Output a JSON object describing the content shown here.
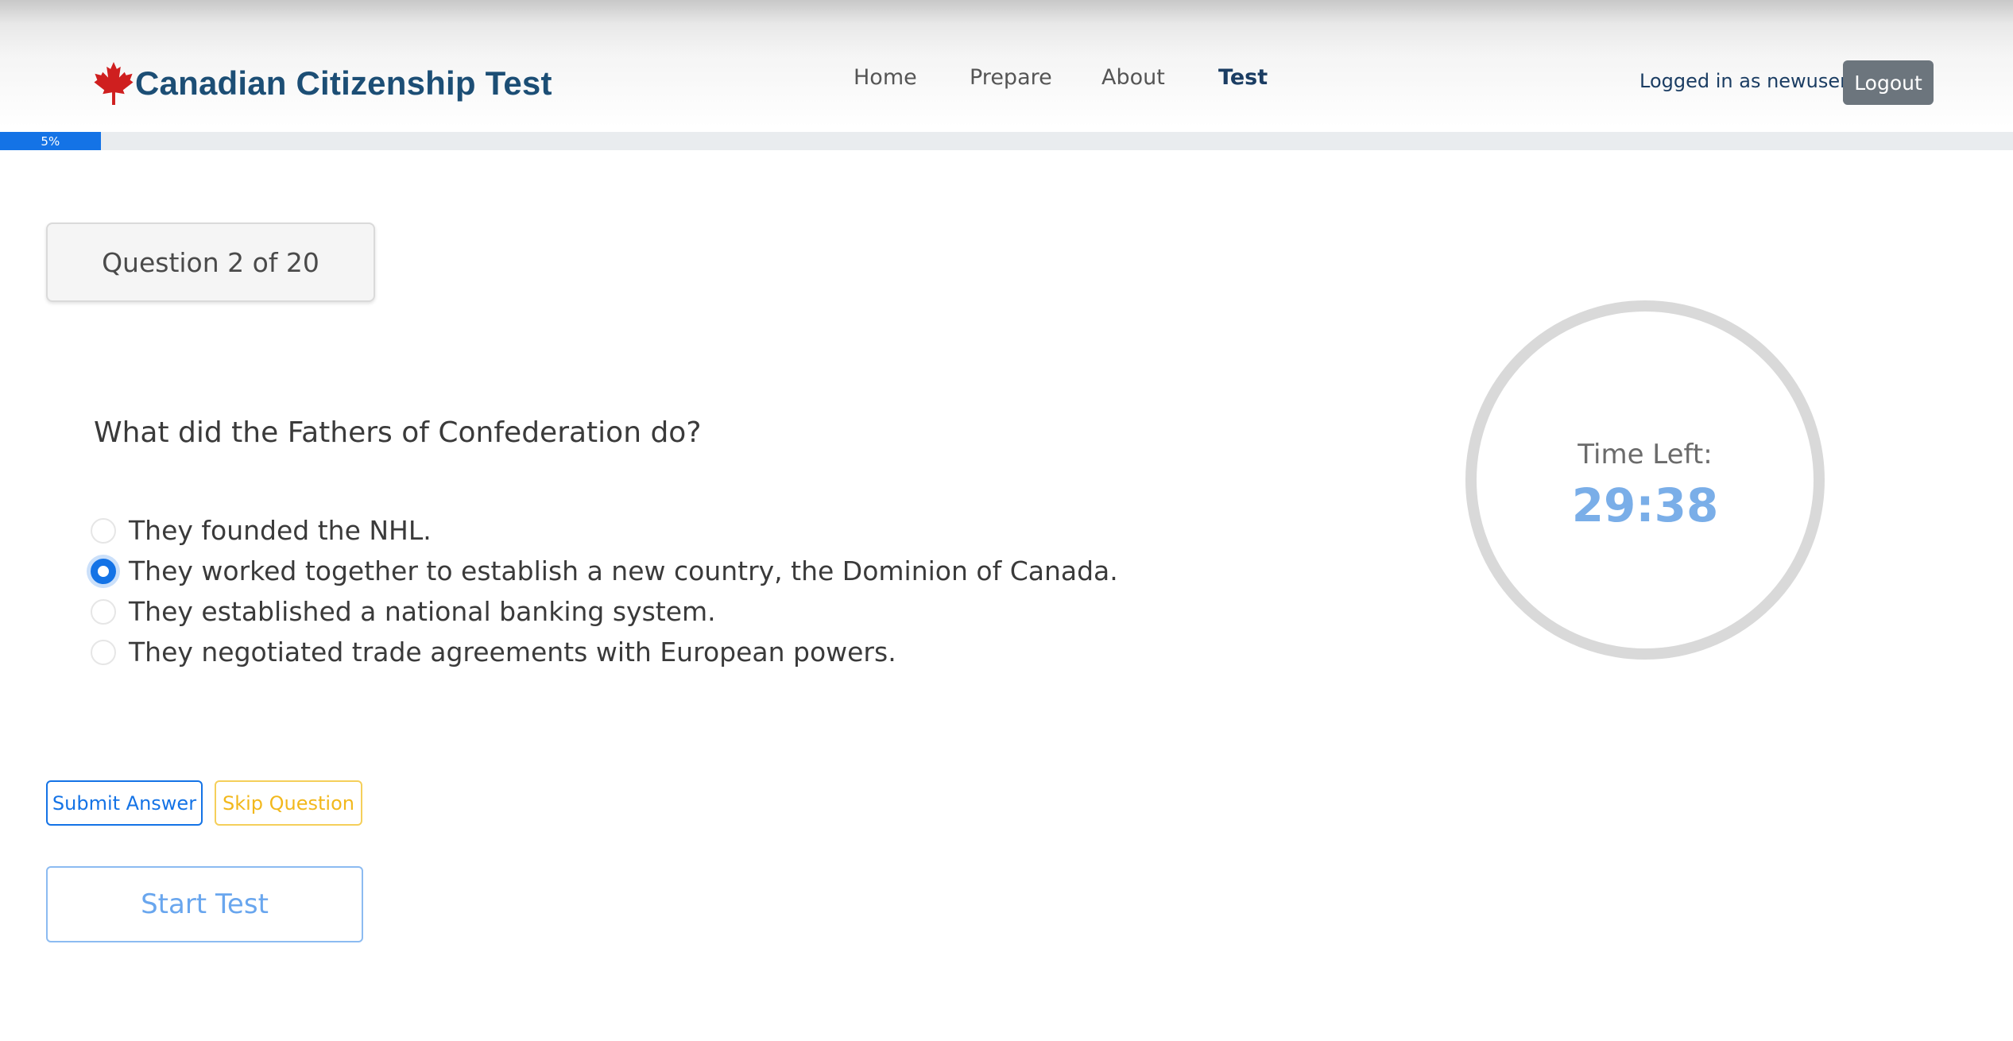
{
  "header": {
    "brand_title": "Canadian Citizenship Test",
    "brand_icon": "maple-leaf-icon",
    "brand_color": "#1c4e75",
    "nav": [
      {
        "label": "Home",
        "active": false
      },
      {
        "label": "Prepare",
        "active": false
      },
      {
        "label": "About",
        "active": false
      },
      {
        "label": "Test",
        "active": true
      }
    ],
    "user_label": "Logged in as newuser",
    "logout_label": "Logout"
  },
  "progress": {
    "percent": 5,
    "label": "5%",
    "color": "#1473e6"
  },
  "quiz": {
    "counter": "Question 2 of 20",
    "question": "What did the Fathers of Confederation do?",
    "options": [
      {
        "label": "They founded the NHL.",
        "selected": false
      },
      {
        "label": "They worked together to establish a new country, the Dominion of Canada.",
        "selected": true
      },
      {
        "label": "They established a national banking system.",
        "selected": false
      },
      {
        "label": "They negotiated trade agreements with European powers.",
        "selected": false
      }
    ]
  },
  "timer": {
    "label": "Time Left:",
    "value": "29:38"
  },
  "actions": {
    "submit_label": "Submit Answer",
    "skip_label": "Skip Question",
    "start_label": "Start Test"
  }
}
